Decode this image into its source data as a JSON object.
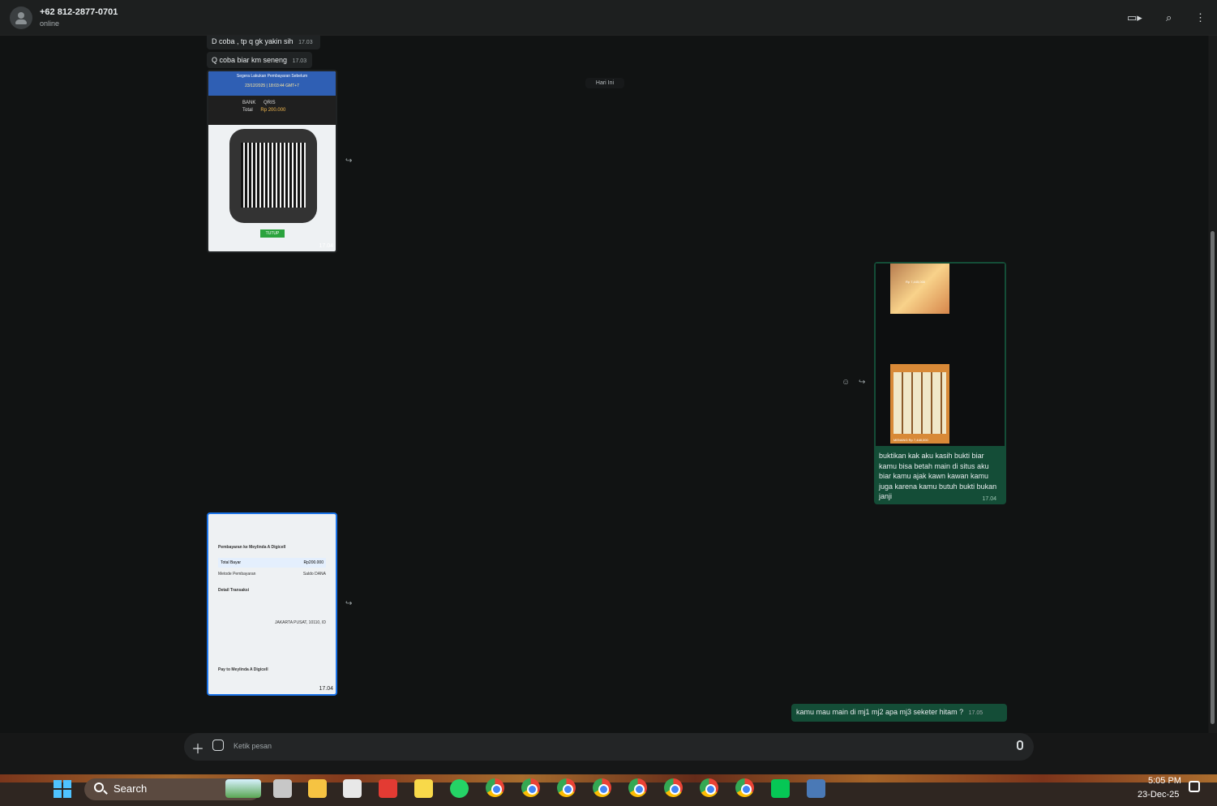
{
  "header": {
    "contact_name": "+62 812-2877-0701",
    "status": "online"
  },
  "chat": {
    "date_label": "Hari Ini",
    "messages": [
      {
        "text": "D coba , tp q gk yakin sih",
        "time": "17.03"
      },
      {
        "text": "Q coba biar km seneng",
        "time": "17.03"
      },
      {
        "time": "17.04"
      },
      {
        "text": "buktikan kak aku kasih bukti biar kamu bisa betah main di situs aku biar kamu ajak kawn kawan kamu juga karena kamu butuh bukti bukan janji",
        "time": "17.04"
      },
      {
        "time": "17.04"
      },
      {
        "text": "kamu mau main di mj1 mj2 apa mj3 seketer hitam ?",
        "time": "17.05"
      }
    ],
    "qris_image": {
      "banner_title": "Segera Lakukan Pembayaran Sebelum",
      "banner_date": "23/12/2025 | 18:03:44 GMT+7",
      "bank_label": "BANK",
      "bank_value": "QRIS",
      "total_label": "Total",
      "total_value": "Rp 200.000",
      "button": "TUTUP"
    },
    "receipt_image": {
      "merchant": "Pembayaran ke Meylinda A Digicell",
      "total_label": "Total Bayar",
      "total_value": "Rp200.000",
      "method_label": "Metode Pembayaran",
      "method_value": "Saldo DANA",
      "details_title": "Detail Transaksi",
      "location": "JAKARTA PUSAT, 10110, ID",
      "footer": "Pay to Meylinda A Digicell"
    },
    "proof_image": {
      "amount": "Rp 7,445,000",
      "jackpot": "MENANG Rp 7,448,000"
    }
  },
  "composer": {
    "placeholder": "Ketik pesan"
  },
  "taskbar": {
    "search": "Search",
    "time": "5:05 PM",
    "date": "23-Dec-25"
  },
  "colors": {
    "accent": "#25d366",
    "outgoing_bubble": "#144d37",
    "incoming_bubble": "#202324"
  }
}
